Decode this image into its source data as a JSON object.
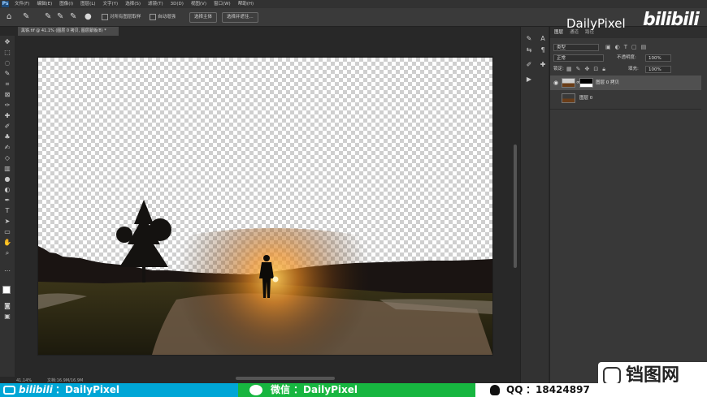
{
  "menu": {
    "items": [
      "文件(F)",
      "编辑(E)",
      "图像(I)",
      "图层(L)",
      "文字(Y)",
      "选择(S)",
      "滤镜(T)",
      "3D(D)",
      "视图(V)",
      "窗口(W)",
      "帮助(H)"
    ]
  },
  "options_bar": {
    "sample_all_layers_label": "对所有图层取样",
    "auto_enhance_label": "自动增强",
    "select_subject_label": "选择主体",
    "select_and_mask_label": "选择并遮住..."
  },
  "document": {
    "tab_title": "黑铁.tif @ 41.1% (图层 0 拷贝, 图层蒙版/8) *"
  },
  "status": {
    "zoom": "41.14%",
    "doc_info": "文档:16.9M/16.9M"
  },
  "layers_panel": {
    "tabs": [
      "图层",
      "通道",
      "路径"
    ],
    "filter_kind": "类型",
    "blend_mode": "正常",
    "opacity_label": "不透明度:",
    "opacity_value": "100%",
    "lock_label": "锁定:",
    "fill_label": "填充:",
    "fill_value": "100%",
    "layers": [
      {
        "name": "图层 0 拷贝",
        "selected": true,
        "has_mask": true
      },
      {
        "name": "图层 0",
        "selected": false,
        "has_mask": false
      }
    ]
  },
  "watermark": {
    "brand": "DailyPixel",
    "logo": "bilibili"
  },
  "footer": {
    "bilibili_label": "bilibili",
    "bilibili_text": "：DailyPixel",
    "wechat_label": "微信",
    "wechat_text": "：DailyPixel",
    "qq_label": "QQ",
    "qq_text": "：18424897",
    "site_mark": "铛图网"
  },
  "colors": {
    "ui_dark": "#282828",
    "panel": "#383838",
    "footer_blue": "#00a6d6",
    "footer_green": "#17b640"
  }
}
